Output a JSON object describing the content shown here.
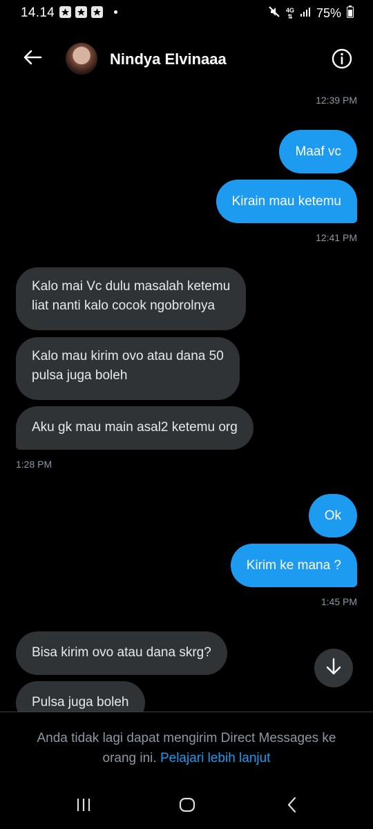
{
  "status_bar": {
    "time": "14.14",
    "battery": "75%",
    "network": "4G"
  },
  "header": {
    "contact_name": "Nindya Elvinaaa",
    "back_icon": "arrow-left-icon",
    "info_icon": "info-circle-icon"
  },
  "messages": [
    {
      "type": "timestamp",
      "side": "right",
      "text": "12:39 PM"
    },
    {
      "type": "message",
      "side": "out",
      "text": "Maaf vc"
    },
    {
      "type": "message",
      "side": "out",
      "text": "Kirain mau ketemu"
    },
    {
      "type": "timestamp",
      "side": "right",
      "text": "12:41 PM"
    },
    {
      "type": "message",
      "side": "in",
      "lines": [
        "Kalo mai Vc dulu masalah ketemu",
        "liat nanti kalo cocok ngobrolnya"
      ]
    },
    {
      "type": "message",
      "side": "in",
      "lines": [
        "Kalo mau kirim ovo atau dana 50",
        "pulsa juga boleh"
      ]
    },
    {
      "type": "message",
      "side": "in",
      "lines": [
        "Aku gk mau main asal2 ketemu org"
      ]
    },
    {
      "type": "timestamp",
      "side": "left",
      "text": "1:28 PM"
    },
    {
      "type": "message",
      "side": "out",
      "text": "Ok"
    },
    {
      "type": "message",
      "side": "out",
      "text": "Kirim ke mana ?"
    },
    {
      "type": "timestamp",
      "side": "right",
      "text": "1:45 PM"
    },
    {
      "type": "message",
      "side": "in",
      "lines": [
        "Bisa kirim ovo atau dana skrg?"
      ]
    },
    {
      "type": "message",
      "side": "in",
      "lines": [
        "Pulsa juga boleh"
      ]
    }
  ],
  "footer": {
    "notice": "Anda tidak lagi dapat mengirim Direct Messages ke orang ini.",
    "link": "Pelajari lebih lanjut"
  },
  "colors": {
    "background": "#000000",
    "outgoing_bubble": "#1d9bf0",
    "incoming_bubble": "#2f3336",
    "timestamp": "#8b98a5",
    "link": "#1d9bf0"
  }
}
